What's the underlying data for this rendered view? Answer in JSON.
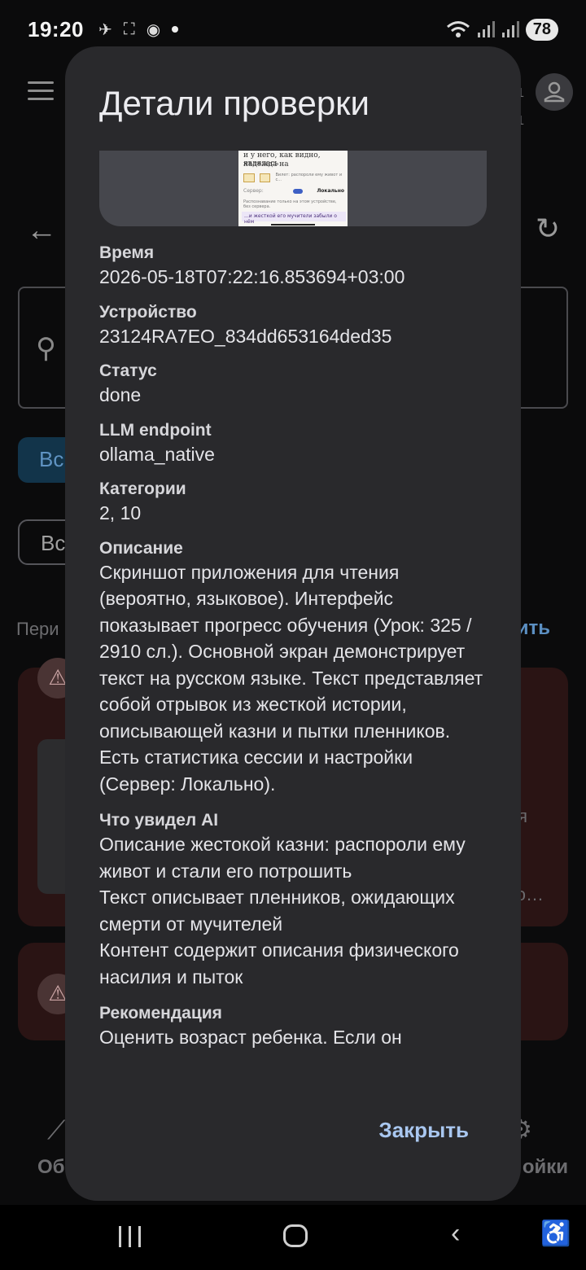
{
  "status_bar": {
    "time": "19:20",
    "battery": "78"
  },
  "background": {
    "chip_blue": "Вс",
    "chip_outline": "Вс",
    "period_text": "Пери",
    "right_action": "ить",
    "tail_1": "я",
    "tail_2": "о…",
    "bottom_left": "Об",
    "bottom_right": "ойки",
    "tiny_top": "1",
    "tiny_bottom": "1"
  },
  "dialog": {
    "title": "Детали проверки",
    "preview": {
      "line1": "и у него, как видно, являлась",
      "line2": "надежда на",
      "button_caption": "Вилет: распороли ему живот и с...",
      "server_label": "Сервер:",
      "server_value": "Локально",
      "note": "Распознавание только на этом устройстве, без сервера.",
      "highlight": "...и жесткой его мучители забыли о нём"
    },
    "fields": [
      {
        "label": "Время",
        "value": "2026-05-18T07:22:16.853694+03:00"
      },
      {
        "label": "Устройство",
        "value": "23124RA7EO_834dd653164ded35"
      },
      {
        "label": "Статус",
        "value": "done"
      },
      {
        "label": "LLM endpoint",
        "value": "ollama_native"
      },
      {
        "label": "Категории",
        "value": "2, 10"
      },
      {
        "label": "Описание",
        "value": "Скриншот приложения для чтения (вероятно, языковое). Интерфейс показывает прогресс обучения (Урок: 325 / 2910 сл.). Основной экран демонстрирует текст на русском языке. Текст представляет собой отрывок из жесткой истории, описывающей казни и пытки пленников. Есть статистика сессии и настройки (Сервер: Локально)."
      },
      {
        "label": "Что увидел AI",
        "value": "Описание жестокой казни: распороли ему живот и стали его потрошить\nТекст описывает пленников, ожидающих смерти от мучителей\nКонтент содержит описания физического насилия и пыток"
      },
      {
        "label": "Рекомендация",
        "value": "Оценить возраст ребенка. Если он"
      }
    ],
    "close_label": "Закрыть"
  },
  "icons": {
    "hamburger": "menu-icon",
    "back": "arrow-back-icon",
    "refresh": "refresh-icon",
    "search": "search-icon",
    "warning": "warning-icon",
    "avatar": "person-icon"
  }
}
